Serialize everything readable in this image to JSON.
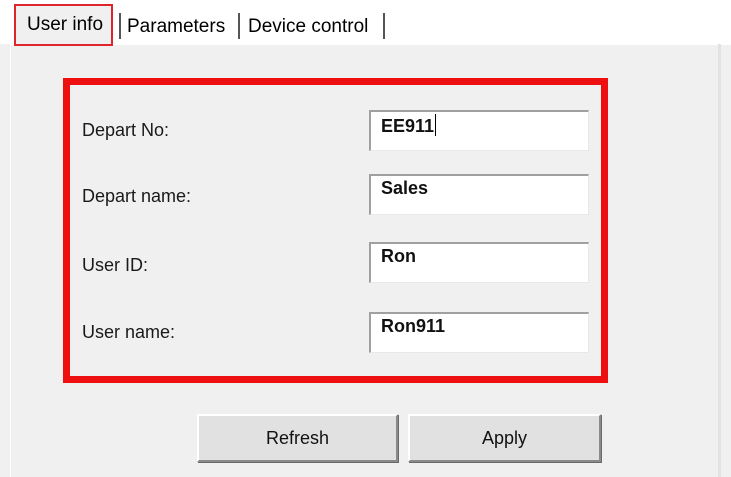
{
  "tabs": [
    {
      "label": "User info",
      "active": true
    },
    {
      "label": "Parameters",
      "active": false
    },
    {
      "label": "Device control",
      "active": false
    }
  ],
  "form": {
    "fields": [
      {
        "label": "Depart No:",
        "value": "EE911"
      },
      {
        "label": "Depart name:",
        "value": "Sales"
      },
      {
        "label": "User ID:",
        "value": "Ron"
      },
      {
        "label": "User name:",
        "value": "Ron911"
      }
    ]
  },
  "buttons": {
    "refresh_label": "Refresh",
    "apply_label": "Apply"
  },
  "colors": {
    "highlight": "#ee1010",
    "active_tab_outline": "#e0242b",
    "panel_background": "#f0f0f0"
  }
}
